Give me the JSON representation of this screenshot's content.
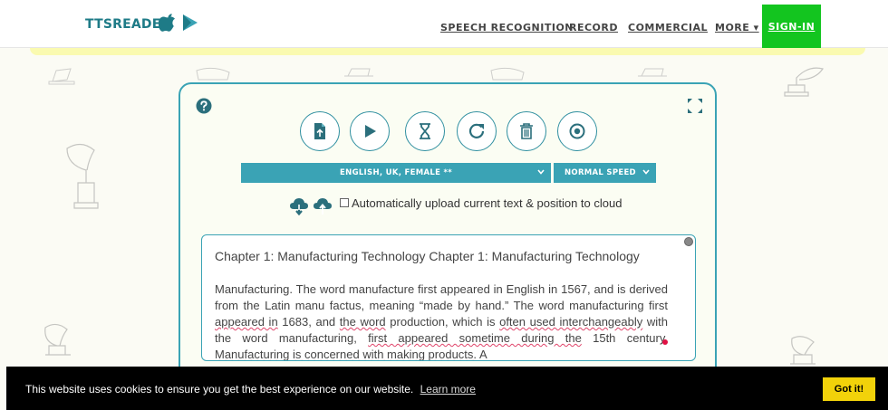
{
  "brand": {
    "name": "TTSREADER",
    "icons": [
      "apple-icon",
      "google-play-icon"
    ],
    "color": "#1e7b87"
  },
  "nav": {
    "links": [
      "SPEECH RECOGNITION",
      "RECORD",
      "COMMERCIAL",
      "MORE ▾"
    ],
    "signin": "SIGN-IN",
    "signin_color": "#13c51f"
  },
  "player": {
    "accent": "#3aa3b5",
    "controls": [
      "upload-file-icon",
      "play-icon",
      "sleep-timer-icon",
      "reload-icon",
      "trash-icon",
      "record-icon"
    ],
    "voice": "ENGLISH, UK, FEMALE **",
    "speed": "NORMAL SPEED",
    "upload_label": "Automatically upload current text & position to cloud",
    "upload_checked": false
  },
  "text": {
    "heading": "Chapter 1: Manufacturing Technology Chapter 1: Manufacturing Technology",
    "p1": "Manufacturing. The word manufacture first appeared in English in 1567, and is derived from the Latin manu factus, meaning “made by hand.” The word manufacturing first ",
    "s1": "appeared in",
    "p2": " 1683, and ",
    "s2": "the word",
    "p3": " production, which is ",
    "s3": "often used interchangeably",
    "p4": " with the word manufacturing, ",
    "s4": "first appeared sometime during the",
    "p5": " 15th century. ",
    "s5": "Manufacturing is concerned with making products.",
    "p6": " A"
  },
  "cookie": {
    "message": "This website uses cookies to ensure you get the best experience on our website.",
    "link": "Learn more",
    "button": "Got it!",
    "button_color": "#f2d20a"
  }
}
